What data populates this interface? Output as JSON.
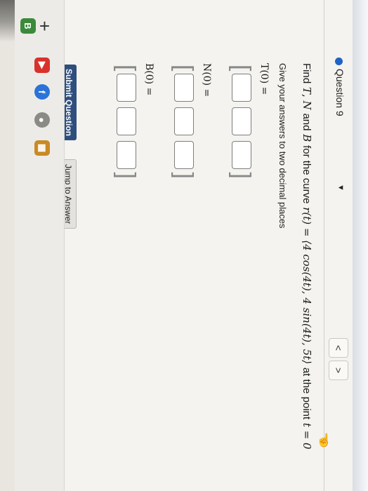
{
  "question": {
    "title": "Question 9",
    "prev": "<",
    "next": ">"
  },
  "sidebar": {
    "add": "+"
  },
  "problem": {
    "find_prefix": "Find",
    "T": "T",
    "comma": ",",
    "N": "N",
    "and": "and",
    "B": "B",
    "middle": "for the curve",
    "curve": "r(t) = ⟨4 cos(4t), 4 sin(4t), 5t⟩",
    "at": "at the point",
    "point": "t = 0"
  },
  "instructions": "Give your answers to two decimal places",
  "vectors": {
    "T_label": "T(0) =",
    "N_label": "N(0) =",
    "B_label": "B(0) ="
  },
  "buttons": {
    "submit": "Submit Question",
    "jump": "Jump to Answer"
  },
  "colors": {
    "accent": "#1f63c4",
    "submit_bg": "#2e4e7e"
  }
}
